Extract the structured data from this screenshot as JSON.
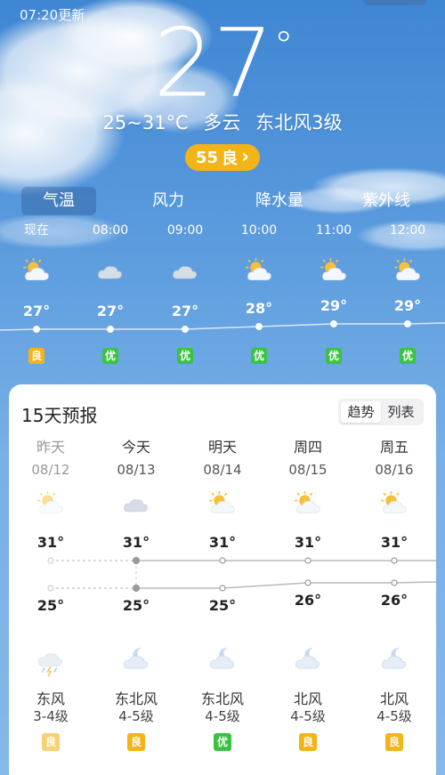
{
  "header": {
    "update_time": "07:20更新",
    "current_temp": "27",
    "degree_symbol": "°",
    "range": "25~31°C",
    "condition": "多云",
    "wind": "东北风3级",
    "aqi": {
      "value": "55",
      "label": "良",
      "arrow": "›",
      "color": "#f3b417"
    }
  },
  "tabs": [
    {
      "label": "气温",
      "active": true
    },
    {
      "label": "风力",
      "active": false
    },
    {
      "label": "降水量",
      "active": false
    },
    {
      "label": "紫外线",
      "active": false
    }
  ],
  "hourly": [
    {
      "time": "现在",
      "icon": "partly-cloudy-icon",
      "temp": "27°",
      "temp_value": 27,
      "aqi": "良",
      "aqi_color": "#f3b417"
    },
    {
      "time": "08:00",
      "icon": "cloudy-icon",
      "temp": "27°",
      "temp_value": 27,
      "aqi": "优",
      "aqi_color": "#39c342"
    },
    {
      "time": "09:00",
      "icon": "cloudy-icon",
      "temp": "27°",
      "temp_value": 27,
      "aqi": "优",
      "aqi_color": "#39c342"
    },
    {
      "time": "10:00",
      "icon": "partly-cloudy-icon",
      "temp": "28°",
      "temp_value": 28,
      "aqi": "优",
      "aqi_color": "#39c342"
    },
    {
      "time": "11:00",
      "icon": "partly-cloudy-icon",
      "temp": "29°",
      "temp_value": 29,
      "aqi": "优",
      "aqi_color": "#39c342"
    },
    {
      "time": "12:00",
      "icon": "partly-cloudy-icon",
      "temp": "29°",
      "temp_value": 29,
      "aqi": "优",
      "aqi_color": "#39c342"
    }
  ],
  "forecast": {
    "title": "15天预报",
    "view_options": [
      "趋势",
      "列表"
    ],
    "selected_view": "趋势",
    "days": [
      {
        "name": "昨天",
        "date": "08/12",
        "day_icon": "partly-cloudy-icon",
        "high": "31°",
        "high_value": 31,
        "low": "25°",
        "low_value": 25,
        "night_icon": "thunderstorm-icon",
        "wind_dir": "东风",
        "wind_level": "3-4级",
        "aqi": "良",
        "aqi_color": "#f3b417",
        "past": true
      },
      {
        "name": "今天",
        "date": "08/13",
        "day_icon": "cloudy-icon",
        "high": "31°",
        "high_value": 31,
        "low": "25°",
        "low_value": 25,
        "night_icon": "cloudy-night-icon",
        "wind_dir": "东北风",
        "wind_level": "4-5级",
        "aqi": "良",
        "aqi_color": "#f3b417",
        "past": false
      },
      {
        "name": "明天",
        "date": "08/14",
        "day_icon": "partly-cloudy-icon",
        "high": "31°",
        "high_value": 31,
        "low": "25°",
        "low_value": 25,
        "night_icon": "cloudy-night-icon",
        "wind_dir": "东北风",
        "wind_level": "4-5级",
        "aqi": "优",
        "aqi_color": "#39c342",
        "past": false
      },
      {
        "name": "周四",
        "date": "08/15",
        "day_icon": "partly-cloudy-icon",
        "high": "31°",
        "high_value": 31,
        "low": "26°",
        "low_value": 26,
        "night_icon": "cloudy-night-icon",
        "wind_dir": "北风",
        "wind_level": "4-5级",
        "aqi": "良",
        "aqi_color": "#f3b417",
        "past": false
      },
      {
        "name": "周五",
        "date": "08/16",
        "day_icon": "partly-cloudy-icon",
        "high": "31°",
        "high_value": 31,
        "low": "26°",
        "low_value": 26,
        "night_icon": "cloudy-night-icon",
        "wind_dir": "北风",
        "wind_level": "4-5级",
        "aqi": "良",
        "aqi_color": "#f3b417",
        "past": false
      }
    ]
  }
}
